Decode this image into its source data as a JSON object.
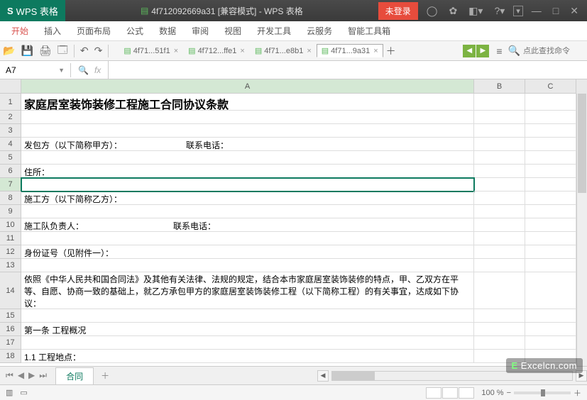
{
  "title": {
    "app": "WPS 表格",
    "doc": "4f712092669a31 [兼容模式] - WPS 表格",
    "login": "未登录"
  },
  "menu": [
    "开始",
    "插入",
    "页面布局",
    "公式",
    "数据",
    "审阅",
    "视图",
    "开发工具",
    "云服务",
    "智能工具箱"
  ],
  "tabs": [
    {
      "label": "4f71...51f1",
      "active": false
    },
    {
      "label": "4f712...ffe1",
      "active": false
    },
    {
      "label": "4f71...e8b1",
      "active": false
    },
    {
      "label": "4f71...9a31",
      "active": true
    }
  ],
  "search_placeholder": "点此查找命令",
  "namebox": "A7",
  "fx": "fx",
  "columns": [
    "A",
    "B",
    "C"
  ],
  "rows": [
    {
      "n": 1,
      "a": "家庭居室装饰装修工程施工合同协议条款"
    },
    {
      "n": 2,
      "a": ""
    },
    {
      "n": 3,
      "a": ""
    },
    {
      "n": 4,
      "a": "发包方（以下简称甲方）：　　　　　　　　联系电话："
    },
    {
      "n": 5,
      "a": ""
    },
    {
      "n": 6,
      "a": "住所："
    },
    {
      "n": 7,
      "a": ""
    },
    {
      "n": 8,
      "a": "施工方（以下简称乙方）："
    },
    {
      "n": 9,
      "a": ""
    },
    {
      "n": 10,
      "a": "施工队负责人：　　　　　　　　　　　联系电话："
    },
    {
      "n": 11,
      "a": ""
    },
    {
      "n": 12,
      "a": "身份证号（见附件一）："
    },
    {
      "n": 13,
      "a": ""
    },
    {
      "n": 14,
      "a": "依照《中华人民共和国合同法》及其他有关法律、法规的规定，结合本市家庭居室装饰装修的特点，甲、乙双方在平等、自愿、协商一致的基础上，就乙方承包甲方的家庭居室装饰装修工程（以下简称工程）的有关事宜，达成如下协议："
    },
    {
      "n": 15,
      "a": ""
    },
    {
      "n": 16,
      "a": "第一条 工程概况"
    },
    {
      "n": 17,
      "a": ""
    },
    {
      "n": 18,
      "a": "1.1 工程地点："
    }
  ],
  "sheet": "合同",
  "zoom": "100 %",
  "watermark": "Excelcn.com"
}
